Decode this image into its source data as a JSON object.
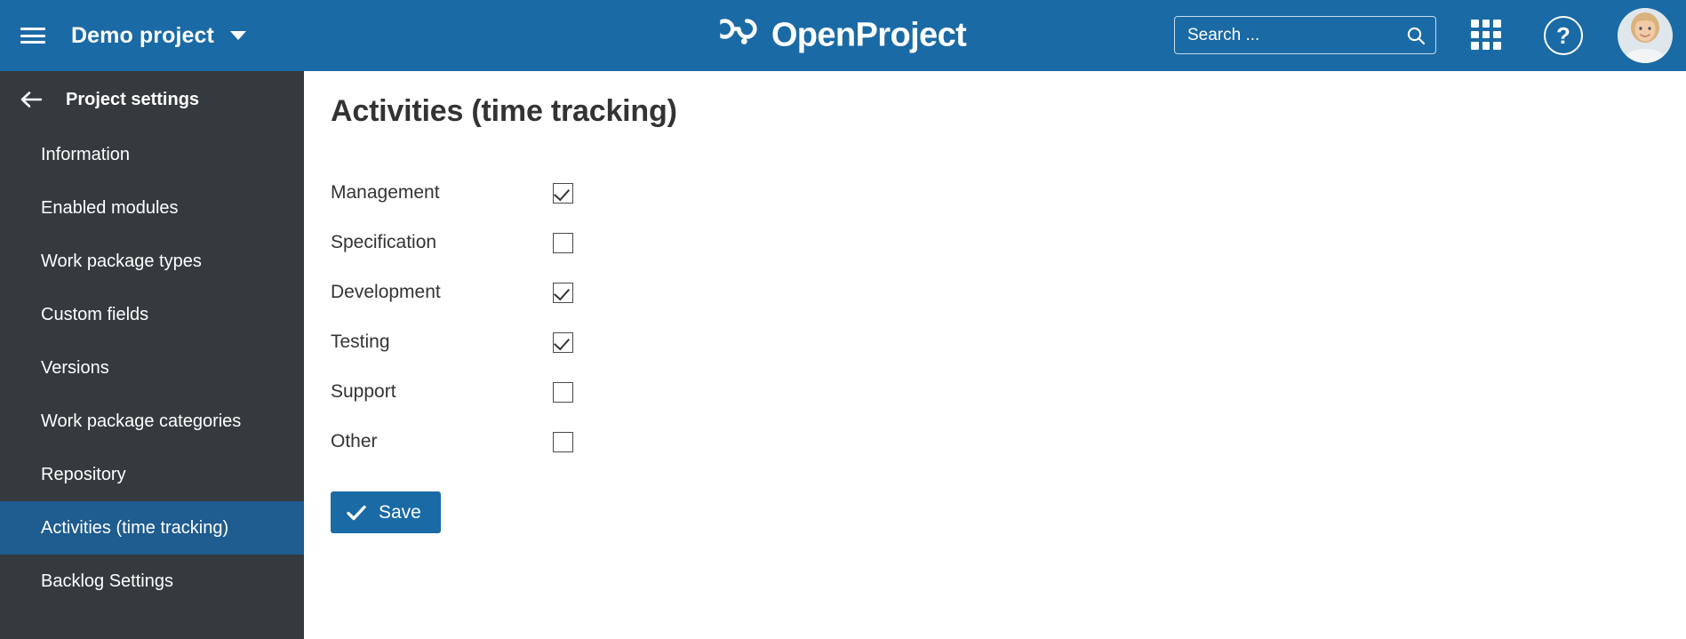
{
  "header": {
    "menu_icon": "hamburger-icon",
    "project_name": "Demo project",
    "project_caret_icon": "chevron-down-icon",
    "brand_name": "OpenProject",
    "brand_mark_icon": "openproject-logo-icon",
    "search": {
      "placeholder": "Search ...",
      "value": "",
      "icon": "search-icon"
    },
    "modules_icon": "grid-apps-icon",
    "help_icon": "question-mark-icon",
    "help_label": "?",
    "avatar_icon": "user-avatar-icon",
    "background_color": "#1A6AA5"
  },
  "sidebar": {
    "back_icon": "arrow-left-icon",
    "title": "Project settings",
    "background_color": "#343a3e",
    "active_color": "#1F5C8F",
    "items": [
      {
        "label": "Information",
        "active": false
      },
      {
        "label": "Enabled modules",
        "active": false
      },
      {
        "label": "Work package types",
        "active": false
      },
      {
        "label": "Custom fields",
        "active": false
      },
      {
        "label": "Versions",
        "active": false
      },
      {
        "label": "Work package categories",
        "active": false
      },
      {
        "label": "Repository",
        "active": false
      },
      {
        "label": "Activities (time tracking)",
        "active": true
      },
      {
        "label": "Backlog Settings",
        "active": false
      }
    ]
  },
  "main": {
    "page_title": "Activities (time tracking)",
    "activities": [
      {
        "label": "Management",
        "checked": true
      },
      {
        "label": "Specification",
        "checked": false
      },
      {
        "label": "Development",
        "checked": true
      },
      {
        "label": "Testing",
        "checked": true
      },
      {
        "label": "Support",
        "checked": false
      },
      {
        "label": "Other",
        "checked": false
      }
    ],
    "save_label": "Save",
    "save_icon": "check-icon",
    "save_color": "#1A6AA5"
  }
}
